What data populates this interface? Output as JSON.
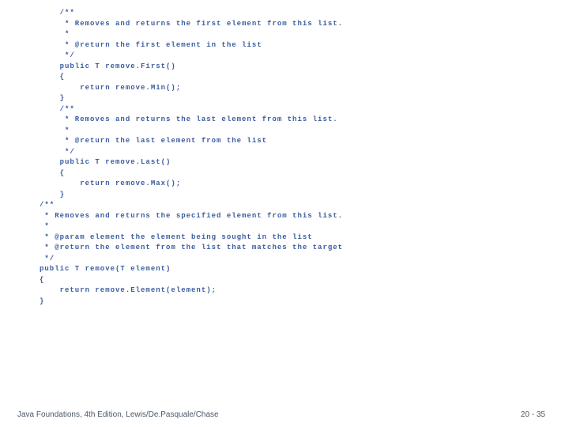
{
  "code": {
    "lines": [
      "/**",
      " * Removes and returns the first element from this list.",
      " *",
      " * @return the first element in the list",
      " */",
      "public T remove.First()",
      "{",
      "    return remove.Min();",
      "}",
      "",
      "/**",
      " * Removes and returns the last element from this list.",
      " *",
      " * @return the last element from the list",
      " */",
      "public T remove.Last()",
      "{",
      "    return remove.Max();",
      "}",
      "",
      "/**",
      " * Removes and returns the specified element from this list.",
      " *",
      " * @param element the element being sought in the list",
      " * @return the element from the list that matches the target",
      " */",
      "public T remove(T element)",
      "{",
      "    return remove.Element(element);",
      "}"
    ],
    "indents": [
      1,
      1,
      1,
      1,
      1,
      1,
      1,
      1,
      1,
      0,
      1,
      1,
      1,
      1,
      1,
      1,
      1,
      1,
      1,
      0,
      0,
      0,
      0,
      0,
      0,
      0,
      0,
      0,
      0,
      0
    ]
  },
  "footer": {
    "left": "Java Foundations, 4th Edition, Lewis/De.Pasquale/Chase",
    "right": "20 - 35"
  }
}
